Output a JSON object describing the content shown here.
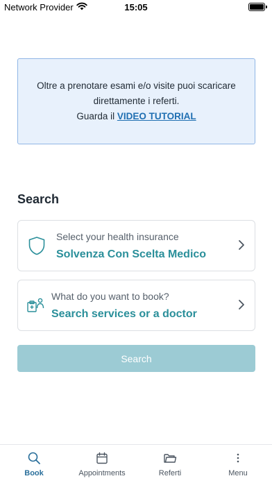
{
  "status_bar": {
    "carrier": "Network Provider",
    "time": "15:05"
  },
  "info": {
    "line1": "Oltre a prenotare esami e/o visite puoi scaricare",
    "line2": "direttamente i referti.",
    "line3_prefix": "Guarda il ",
    "link_label": "VIDEO TUTORIAL"
  },
  "search_section": {
    "title": "Search",
    "insurance_card": {
      "subtitle": "Select your health insurance",
      "value": "Solvenza Con Scelta Medico",
      "icon": "shield-icon"
    },
    "booking_card": {
      "subtitle": "What do you want to book?",
      "value": "Search services or a doctor",
      "icon": "clipboard-doctor-icon"
    },
    "button_label": "Search"
  },
  "tabs": [
    {
      "label": "Book",
      "icon": "search-icon",
      "active": true
    },
    {
      "label": "Appointments",
      "icon": "calendar-icon",
      "active": false
    },
    {
      "label": "Referti",
      "icon": "folder-icon",
      "active": false
    },
    {
      "label": "Menu",
      "icon": "more-vertical-icon",
      "active": false
    }
  ],
  "colors": {
    "accent": "#2a8f9a",
    "info_background": "#e8f1fc",
    "info_border": "#8fb5e6",
    "link": "#1f6fb2",
    "button_disabled": "#9ccbd4"
  }
}
